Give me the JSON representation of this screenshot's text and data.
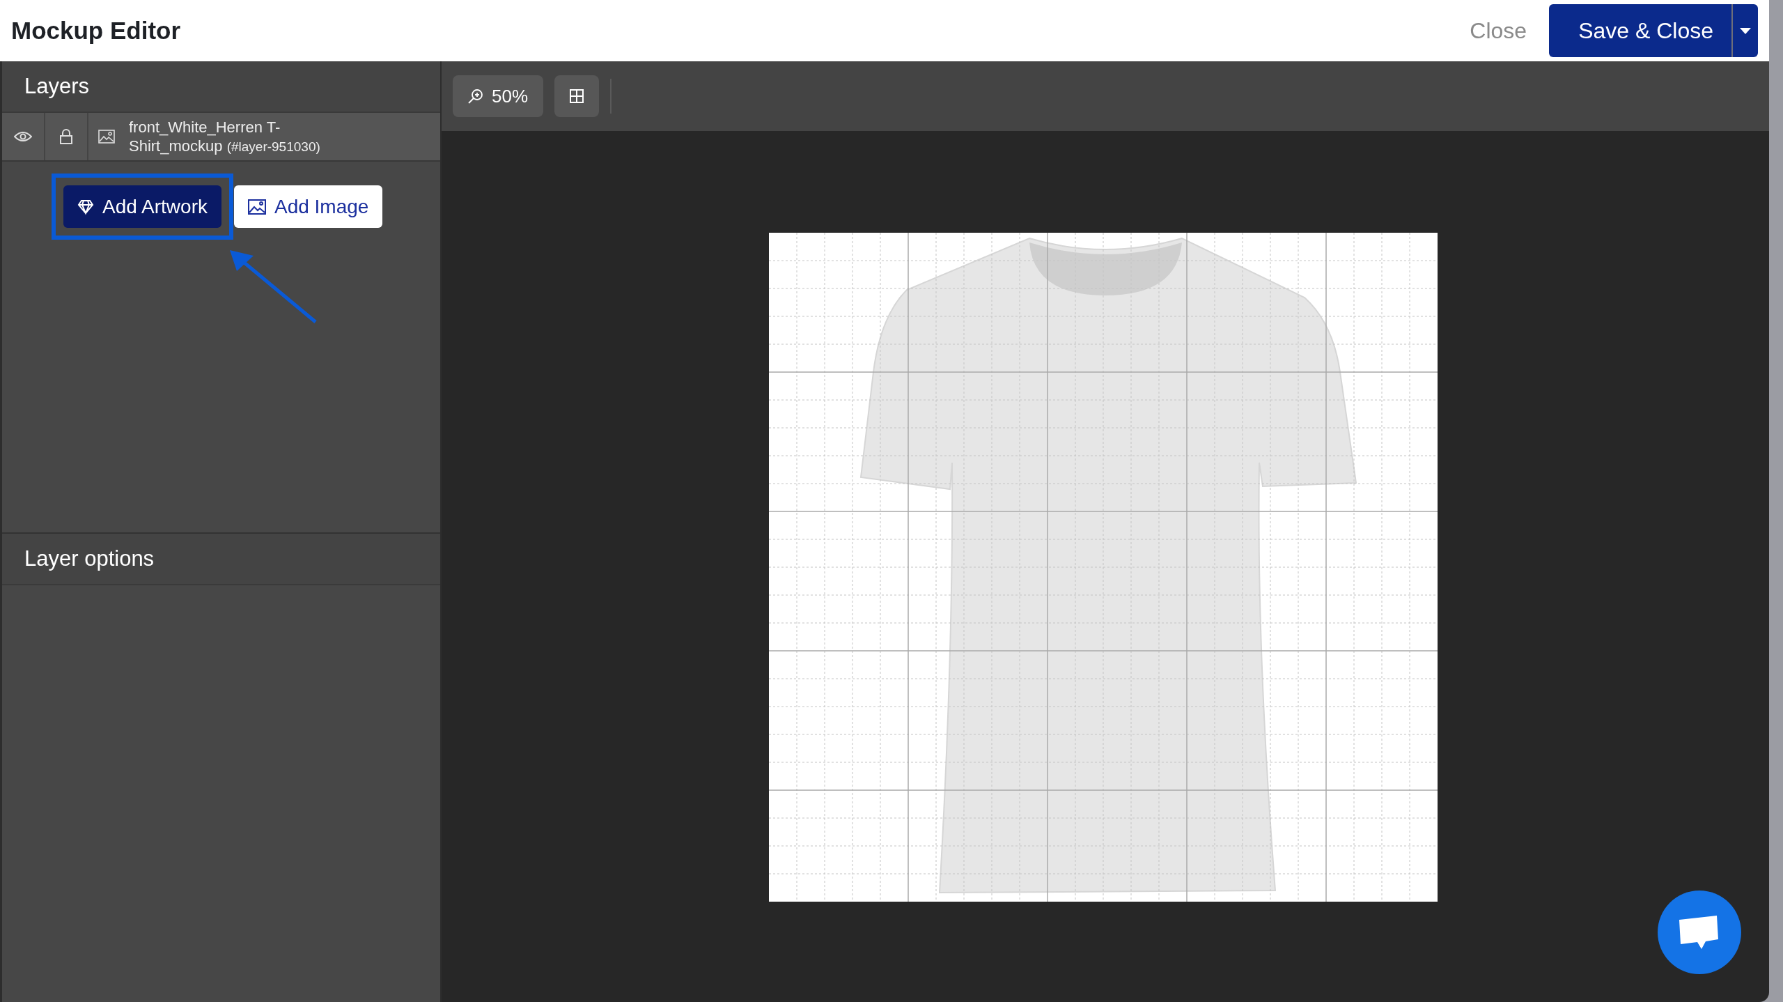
{
  "header": {
    "title": "Mockup Editor",
    "close_label": "Close",
    "save_label": "Save & Close"
  },
  "layers_panel": {
    "title": "Layers",
    "layers": [
      {
        "name": "front_White_Herren T-Shirt_mockup",
        "id": "(#layer-951030)"
      }
    ],
    "buttons": [
      {
        "kind": "primary",
        "label": "Add Artwork",
        "highlighted": true
      },
      {
        "kind": "secondary",
        "label": "Add Image",
        "highlighted": false
      }
    ]
  },
  "layer_options": {
    "title": "Layer options"
  },
  "toolbar": {
    "zoom": "50%"
  }
}
